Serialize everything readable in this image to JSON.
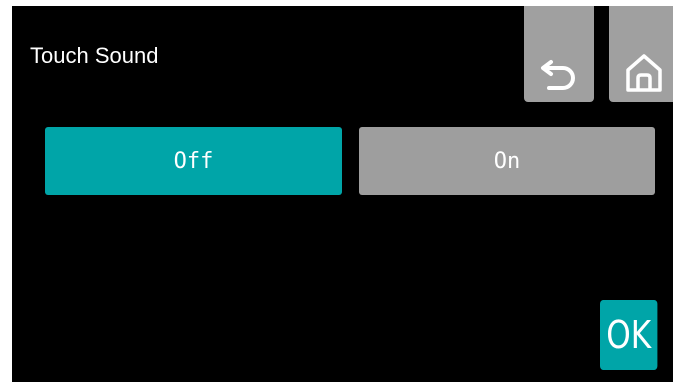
{
  "header": {
    "title": "Touch Sound"
  },
  "nav": {
    "back_icon": "undo-arrow-icon",
    "home_icon": "home-icon"
  },
  "options": {
    "off_label": "Off",
    "on_label": "On",
    "selected": "Off"
  },
  "footer": {
    "ok_label": "OK"
  },
  "colors": {
    "background": "#000000",
    "selected": "#00a5a8",
    "unselected": "#9e9e9e",
    "nav_button": "#a0a0a0",
    "text": "#ffffff"
  }
}
